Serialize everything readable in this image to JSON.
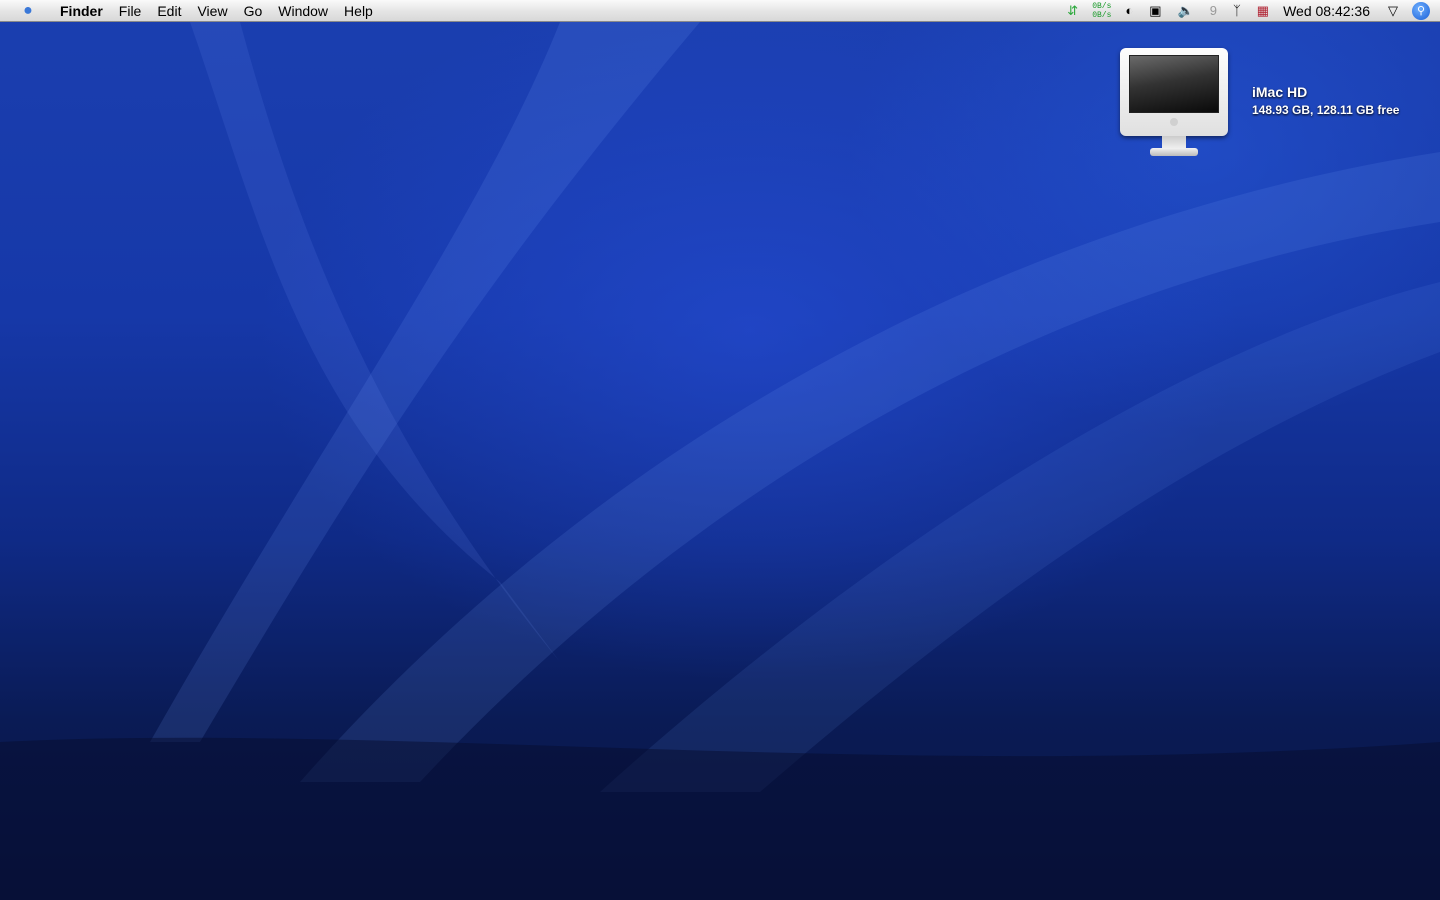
{
  "menubar": {
    "apple_icon": "apple-logo",
    "items": [
      "Finder",
      "File",
      "Edit",
      "View",
      "Go",
      "Window",
      "Help"
    ],
    "status": {
      "net_up": "0B/s",
      "net_down": "0B/s",
      "clock": "Wed 08:42:36",
      "icons": [
        "sync-icon",
        "network-monitor",
        "time-machine-icon",
        "display-icon",
        "volume-icon",
        "script-icon",
        "bluetooth-icon",
        "uk-flag-input-icon",
        "wifi-icon",
        "spotlight-icon"
      ]
    }
  },
  "desktop": {
    "icons": [
      {
        "name": "iMac HD",
        "info": "148.93 GB, 128.11 GB free"
      }
    ]
  },
  "colors": {
    "wallpaper": "#1638a8",
    "accent": "#3a78d8"
  }
}
